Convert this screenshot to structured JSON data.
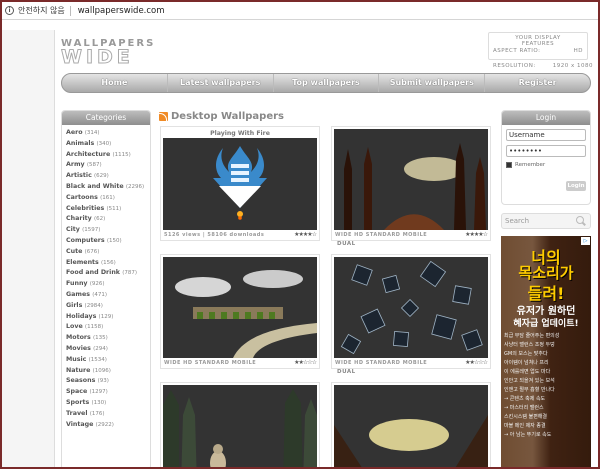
{
  "browser": {
    "security_label": "안전하지 않음",
    "url": "wallpaperswide.com"
  },
  "header": {
    "logo_top": "WALLPAPERS",
    "logo_bottom": "WIDE",
    "display_line1": "YOUR DISPLAY",
    "display_line2": "FEATURES",
    "aspect_label": "ASPECT RATIO:",
    "aspect_value": "HD",
    "resolution_label": "RESOLUTION:",
    "resolution_value": "1920 x 1080"
  },
  "nav": [
    {
      "label": "Home"
    },
    {
      "label": "Latest wallpapers"
    },
    {
      "label": "Top wallpapers"
    },
    {
      "label": "Submit wallpapers"
    },
    {
      "label": "Register"
    }
  ],
  "categories": {
    "title": "Categories",
    "items": [
      {
        "name": "Aero",
        "count": "(314)"
      },
      {
        "name": "Animals",
        "count": "(340)"
      },
      {
        "name": "Architecture",
        "count": "(1115)"
      },
      {
        "name": "Army",
        "count": "(587)"
      },
      {
        "name": "Artistic",
        "count": "(629)"
      },
      {
        "name": "Black and White",
        "count": "(2296)"
      },
      {
        "name": "Cartoons",
        "count": "(161)"
      },
      {
        "name": "Celebrities",
        "count": "(511)"
      },
      {
        "name": "Charity",
        "count": "(62)"
      },
      {
        "name": "City",
        "count": "(1597)"
      },
      {
        "name": "Computers",
        "count": "(150)"
      },
      {
        "name": "Cute",
        "count": "(676)"
      },
      {
        "name": "Elements",
        "count": "(156)"
      },
      {
        "name": "Food and Drink",
        "count": "(787)"
      },
      {
        "name": "Funny",
        "count": "(926)"
      },
      {
        "name": "Games",
        "count": "(471)"
      },
      {
        "name": "Girls",
        "count": "(2984)"
      },
      {
        "name": "Holidays",
        "count": "(129)"
      },
      {
        "name": "Love",
        "count": "(1158)"
      },
      {
        "name": "Motors",
        "count": "(135)"
      },
      {
        "name": "Movies",
        "count": "(294)"
      },
      {
        "name": "Music",
        "count": "(1534)"
      },
      {
        "name": "Nature",
        "count": "(1096)"
      },
      {
        "name": "Seasons",
        "count": "(93)"
      },
      {
        "name": "Space",
        "count": "(1297)"
      },
      {
        "name": "Sports",
        "count": "(130)"
      },
      {
        "name": "Travel",
        "count": "(176)"
      },
      {
        "name": "Vintage",
        "count": "(2922)"
      }
    ]
  },
  "main": {
    "section_title": "Desktop Wallpapers",
    "cards": [
      {
        "title": "Playing With Fire",
        "meta_left": "5126 views | 58106 downloads",
        "stars": "★★★★☆",
        "extra": ""
      },
      {
        "title": "",
        "meta_left": "WIDE  HD  STANDARD  MOBILE",
        "stars": "★★★★☆",
        "extra": "DUAL"
      },
      {
        "title": "",
        "meta_left": "WIDE  HD  STANDARD  MOBILE",
        "stars": "★★☆☆☆",
        "extra": ""
      },
      {
        "title": "",
        "meta_left": "WIDE  HD  STANDARD  MOBILE",
        "stars": "★★☆☆☆",
        "extra": "DUAL"
      },
      {
        "title": "",
        "meta_left": "",
        "stars": "",
        "extra": ""
      },
      {
        "title": "",
        "meta_left": "",
        "stars": "",
        "extra": ""
      }
    ]
  },
  "login": {
    "title": "Login",
    "username_value": "Username",
    "password_value": "••••••••",
    "remember_label": "Remember",
    "button_label": "Login"
  },
  "search": {
    "placeholder": "Search"
  },
  "ad": {
    "line1": "너의",
    "line2": "목소리가",
    "line3": "들려!",
    "line4": "유저가 원하던",
    "line5": "혜자급 업데이트!",
    "bullets": [
      "최급 부담 줄어주는 편의성",
      "사냥터 밸런스 조정 두덩",
      "GM의 보스는 맞추다",
      "아이템이 넘쳐나 프리",
      "이 에를레면 업도 마다",
      "인안고 되을겨 있는 보석",
      "인앤고 쩔부 흡혈 만나다",
      "→ 콘텐츠 축제 속도",
      "→ 마스터리 밸런스",
      "스킨시스템 불편해결",
      "마블 메인 제자 종결",
      "→ 아 남는 뚜기로 속도"
    ]
  },
  "colors": {
    "frame_border": "#7a2a2a",
    "nav_top": "#e4e4e4",
    "nav_bottom": "#a9a9a9",
    "ad_yellow": "#ffcc00"
  }
}
